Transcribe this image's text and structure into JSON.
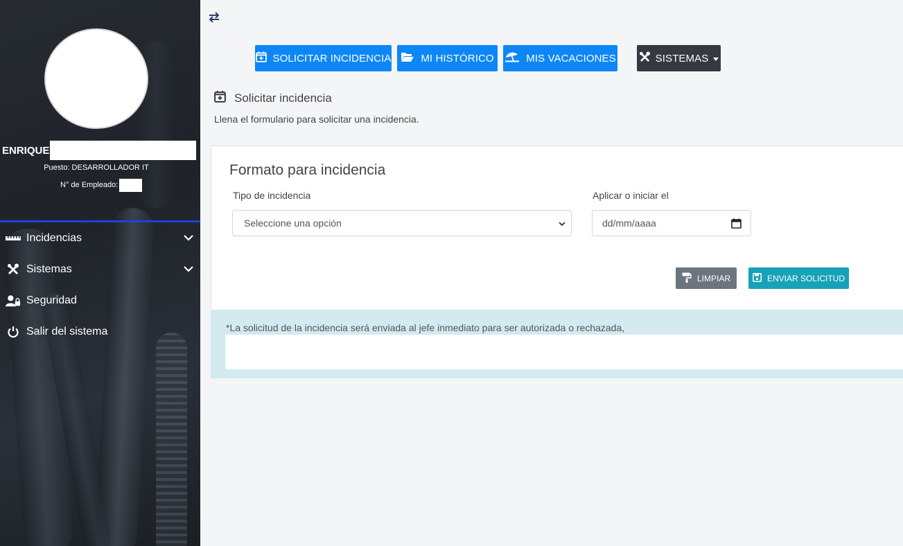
{
  "user": {
    "name": "ENRIQUE",
    "position": "Puesto: DESARROLLADOR IT",
    "employee_label": "N° de Empleado:"
  },
  "sidebar": {
    "items": [
      {
        "label": "Incidencias",
        "icon": "ruler-icon",
        "expandable": true
      },
      {
        "label": "Sistemas",
        "icon": "tools-icon",
        "expandable": true
      },
      {
        "label": "Seguridad",
        "icon": "user-lock-icon",
        "expandable": false
      },
      {
        "label": "Salir del sistema",
        "icon": "power-icon",
        "expandable": false
      }
    ]
  },
  "topbar": {
    "toggle_icon": "swap-arrows-icon",
    "buttons": [
      {
        "label": "SOLICITAR INCIDENCIA",
        "icon": "calendar-plus-icon"
      },
      {
        "label": "MI HISTÓRICO",
        "icon": "folder-open-icon"
      },
      {
        "label": "MIS VACACIONES",
        "icon": "umbrella-beach-icon"
      },
      {
        "label": "SISTEMAS",
        "icon": "tools-icon"
      }
    ]
  },
  "section": {
    "title": "Solicitar incidencia",
    "description": "Llena el formulario para solicitar una incidencia."
  },
  "form": {
    "title": "Formato para incidencia",
    "type_label": "Tipo de incidencia",
    "type_value": "Seleccione una opción",
    "date_label": "Aplicar o iniciar el",
    "date_placeholder": "dd/mm/aaaa",
    "clear_label": "LIMPIAR",
    "submit_label": "ENVIAR SOLICITUD"
  },
  "notice": {
    "text": "*La solicitud de la incidencia será enviada al jefe inmediato para ser autorizada o rechazada,"
  },
  "colors": {
    "primary": "#0d87f5",
    "dark": "#343a40",
    "info": "#17a2b8",
    "secondary": "#6c757d",
    "notice_bg": "#d2eaf0",
    "sidebar_divider": "#1e43d6"
  }
}
